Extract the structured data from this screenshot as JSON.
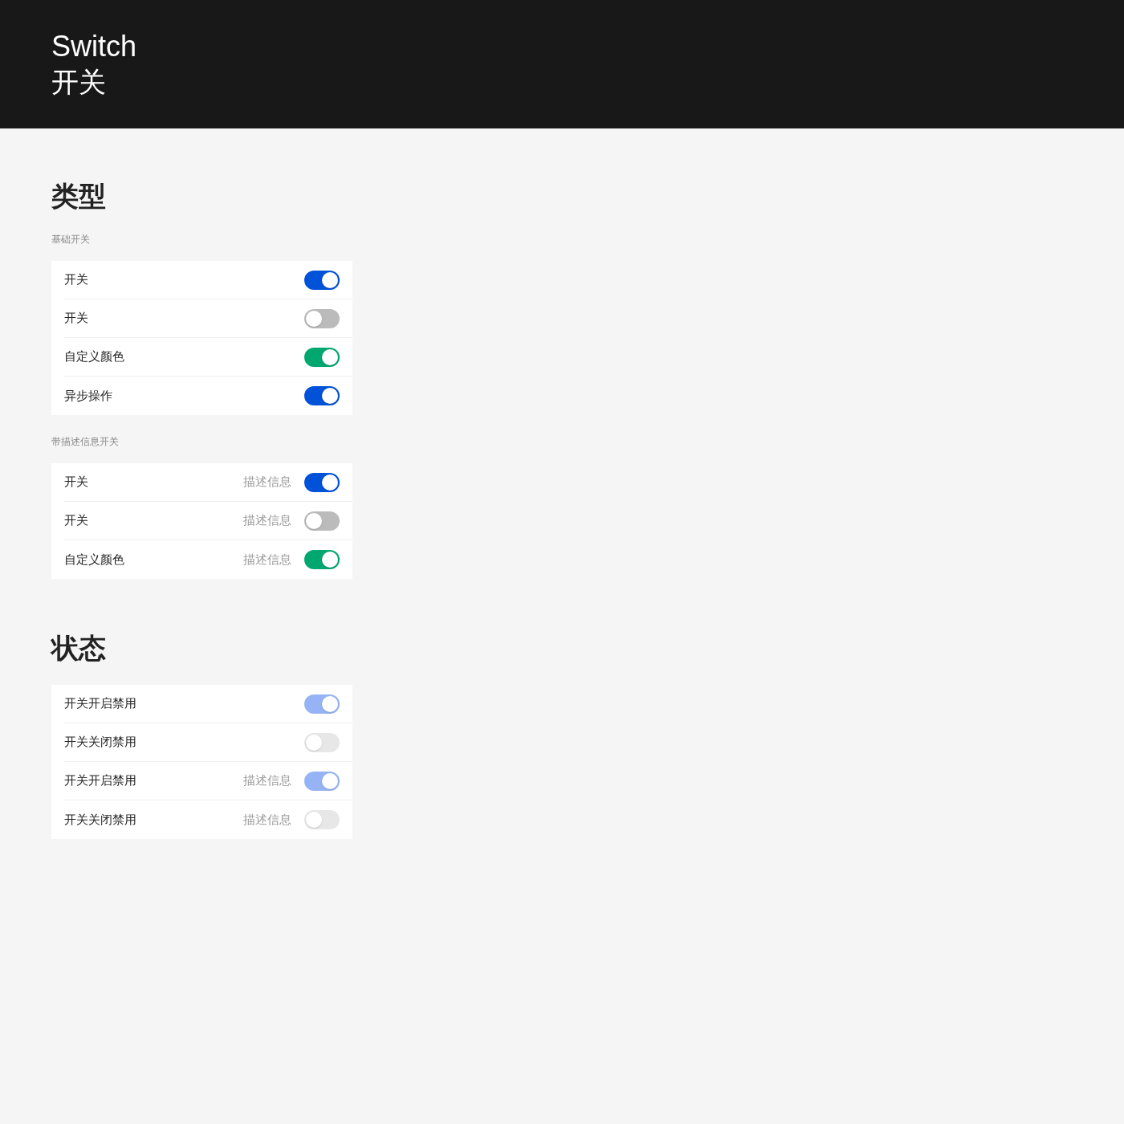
{
  "header": {
    "title": "Switch",
    "subtitle": "开关"
  },
  "sections": [
    {
      "title": "类型",
      "groups": [
        {
          "label": "基础开关",
          "items": [
            {
              "label": "开关",
              "checked": true,
              "disabled": false
            },
            {
              "label": "开关",
              "checked": false,
              "disabled": false
            },
            {
              "label": "自定义颜色",
              "checked": true,
              "disabled": false,
              "color": "#00a870"
            },
            {
              "label": "异步操作",
              "checked": true,
              "disabled": false
            }
          ]
        },
        {
          "label": "带描述信息开关",
          "items": [
            {
              "label": "开关",
              "description": "描述信息",
              "checked": true,
              "disabled": false
            },
            {
              "label": "开关",
              "description": "描述信息",
              "checked": false,
              "disabled": false
            },
            {
              "label": "自定义颜色",
              "description": "描述信息",
              "checked": true,
              "disabled": false,
              "color": "#00a870"
            }
          ]
        }
      ]
    },
    {
      "title": "状态",
      "groups": [
        {
          "items": [
            {
              "label": "开关开启禁用",
              "checked": true,
              "disabled": true
            },
            {
              "label": "开关关闭禁用",
              "checked": false,
              "disabled": true
            },
            {
              "label": "开关开启禁用",
              "description": "描述信息",
              "checked": true,
              "disabled": true
            },
            {
              "label": "开关关闭禁用",
              "description": "描述信息",
              "checked": false,
              "disabled": true
            }
          ]
        }
      ]
    }
  ]
}
